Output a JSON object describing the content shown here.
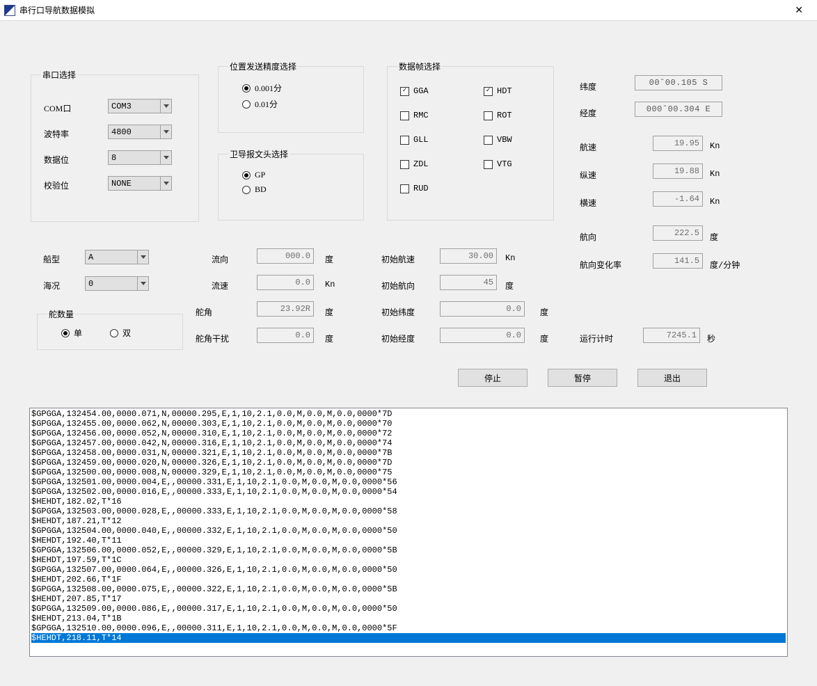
{
  "window": {
    "title": "串行口导航数据模拟"
  },
  "serial": {
    "legend": "串口选择",
    "com_label": "COM口",
    "com_value": "COM3",
    "baud_label": "波特率",
    "baud_value": "4800",
    "data_label": "数据位",
    "data_value": "8",
    "parity_label": "校验位",
    "parity_value": "NONE"
  },
  "precision": {
    "legend": "位置发送精度选择",
    "opt1": "0.001分",
    "opt2": "0.01分",
    "selected": 1
  },
  "talker": {
    "legend": "卫导报文头选择",
    "opt1": "GP",
    "opt2": "BD",
    "selected": 1
  },
  "frames": {
    "legend": "数据帧选择",
    "left": [
      {
        "label": "GGA",
        "checked": true
      },
      {
        "label": "RMC",
        "checked": false
      },
      {
        "label": "GLL",
        "checked": false
      },
      {
        "label": "ZDL",
        "checked": false
      },
      {
        "label": "RUD",
        "checked": false
      }
    ],
    "right": [
      {
        "label": "HDT",
        "checked": true
      },
      {
        "label": "ROT",
        "checked": false
      },
      {
        "label": "VBW",
        "checked": false
      },
      {
        "label": "VTG",
        "checked": false
      }
    ]
  },
  "ship": {
    "type_label": "船型",
    "type_value": "A",
    "sea_label": "海况",
    "sea_value": "0"
  },
  "rudder_count": {
    "legend": "舵数量",
    "opt1": "单",
    "opt2": "双",
    "selected": 1
  },
  "flow": {
    "dir_label": "流向",
    "dir_value": "000.0",
    "dir_unit": "度",
    "spd_label": "流速",
    "spd_value": "0.0",
    "spd_unit": "Kn",
    "rud_label": "舵角",
    "rud_value": "23.92R",
    "rud_unit": "度",
    "rudn_label": "舵角干扰",
    "rudn_value": "0.0",
    "rudn_unit": "度"
  },
  "init": {
    "spd_label": "初始航速",
    "spd_value": "30.00",
    "spd_unit": "Kn",
    "hdg_label": "初始航向",
    "hdg_value": "45",
    "hdg_unit": "度",
    "lat_label": "初始纬度",
    "lat_value": "0.0",
    "lat_unit": "度",
    "lon_label": "初始经度",
    "lon_value": "0.0",
    "lon_unit": "度"
  },
  "readout": {
    "lat_label": "纬度",
    "lat_value": "00ˆ00.105 S",
    "lon_label": "经度",
    "lon_value": "000ˆ00.304 E",
    "sog_label": "航速",
    "sog_value": "19.95",
    "sog_unit": "Kn",
    "long_label": "纵速",
    "long_value": "19.88",
    "long_unit": "Kn",
    "trans_label": "横速",
    "trans_value": "-1.64",
    "trans_unit": "Kn",
    "hdg_label": "航向",
    "hdg_value": "222.5",
    "hdg_unit": "度",
    "rot_label": "航向变化率",
    "rot_value": "141.5",
    "rot_unit": "度/分钟",
    "time_label": "运行计时",
    "time_value": "7245.1",
    "time_unit": "秒"
  },
  "buttons": {
    "stop": "停止",
    "pause": "暂停",
    "exit": "退出"
  },
  "log_lines": [
    "$GPGGA,132454.00,0000.071,N,00000.295,E,1,10,2.1,0.0,M,0.0,M,0.0,0000*7D",
    "$GPGGA,132455.00,0000.062,N,00000.303,E,1,10,2.1,0.0,M,0.0,M,0.0,0000*70",
    "$GPGGA,132456.00,0000.052,N,00000.310,E,1,10,2.1,0.0,M,0.0,M,0.0,0000*72",
    "$GPGGA,132457.00,0000.042,N,00000.316,E,1,10,2.1,0.0,M,0.0,M,0.0,0000*74",
    "$GPGGA,132458.00,0000.031,N,00000.321,E,1,10,2.1,0.0,M,0.0,M,0.0,0000*7B",
    "$GPGGA,132459.00,0000.020,N,00000.326,E,1,10,2.1,0.0,M,0.0,M,0.0,0000*7D",
    "$GPGGA,132500.00,0000.008,N,00000.329,E,1,10,2.1,0.0,M,0.0,M,0.0,0000*75",
    "$GPGGA,132501.00,0000.004,E,,00000.331,E,1,10,2.1,0.0,M,0.0,M,0.0,0000*56",
    "$GPGGA,132502.00,0000.016,E,,00000.333,E,1,10,2.1,0.0,M,0.0,M,0.0,0000*54",
    "$HEHDT,182.02,T*16",
    "$GPGGA,132503.00,0000.028,E,,00000.333,E,1,10,2.1,0.0,M,0.0,M,0.0,0000*58",
    "$HEHDT,187.21,T*12",
    "$GPGGA,132504.00,0000.040,E,,00000.332,E,1,10,2.1,0.0,M,0.0,M,0.0,0000*50",
    "$HEHDT,192.40,T*11",
    "$GPGGA,132506.00,0000.052,E,,00000.329,E,1,10,2.1,0.0,M,0.0,M,0.0,0000*5B",
    "$HEHDT,197.59,T*1C",
    "$GPGGA,132507.00,0000.064,E,,00000.326,E,1,10,2.1,0.0,M,0.0,M,0.0,0000*50",
    "$HEHDT,202.66,T*1F",
    "$GPGGA,132508.00,0000.075,E,,00000.322,E,1,10,2.1,0.0,M,0.0,M,0.0,0000*5B",
    "$HEHDT,207.85,T*17",
    "$GPGGA,132509.00,0000.086,E,,00000.317,E,1,10,2.1,0.0,M,0.0,M,0.0,0000*50",
    "$HEHDT,213.04,T*1B",
    "$GPGGA,132510.00,0000.096,E,,00000.311,E,1,10,2.1,0.0,M,0.0,M,0.0,0000*5F",
    "$HEHDT,218.11,T*14"
  ],
  "log_selected_index": 23
}
